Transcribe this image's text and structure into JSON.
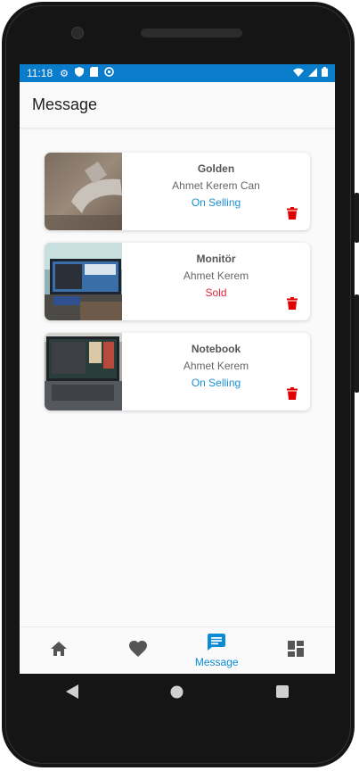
{
  "status_bar": {
    "time": "11:18"
  },
  "app_bar": {
    "title": "Message"
  },
  "items": [
    {
      "name": "Golden",
      "seller": "Ahmet Kerem Can",
      "status": "On Selling",
      "status_color": "#1a8fd6"
    },
    {
      "name": "Monitör",
      "seller": "Ahmet Kerem",
      "status": "Sold",
      "status_color": "#e0263a"
    },
    {
      "name": "Notebook",
      "seller": "Ahmet Kerem",
      "status": "On Selling",
      "status_color": "#1a8fd6"
    }
  ],
  "bottom_nav": {
    "items": [
      {
        "icon": "home-icon",
        "label": ""
      },
      {
        "icon": "heart-icon",
        "label": ""
      },
      {
        "icon": "message-icon",
        "label": "Message"
      },
      {
        "icon": "dashboard-icon",
        "label": ""
      }
    ],
    "active_color": "#0a8bd6"
  },
  "colors": {
    "status_bar": "#0a7ccc",
    "delete": "#e00000"
  }
}
